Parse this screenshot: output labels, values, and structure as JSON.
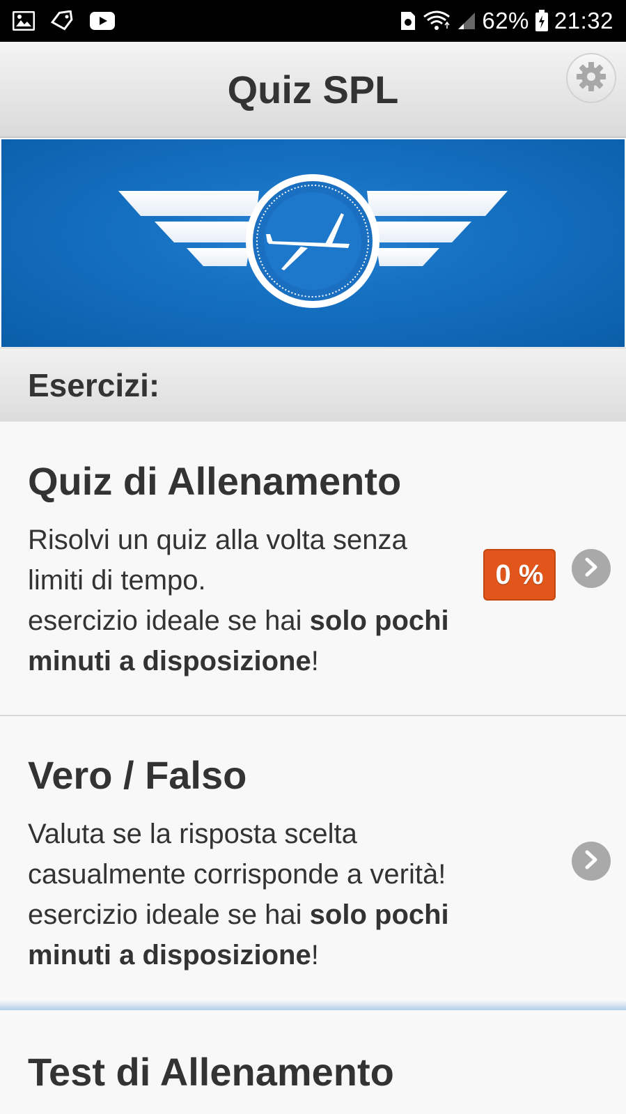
{
  "status_bar": {
    "battery_percent": "62%",
    "time": "21:32",
    "left_icons": [
      "gallery-icon",
      "tag-icon",
      "youtube-icon"
    ],
    "right_icons": [
      "sim-icon",
      "wifi-icon",
      "signal-icon",
      "battery-icon"
    ]
  },
  "header": {
    "title": "Quiz SPL",
    "settings_icon": "gear-icon"
  },
  "banner": {
    "logo": "glider-wings-emblem"
  },
  "section": {
    "title": "Esercizi:"
  },
  "items": [
    {
      "title": "Quiz di Allenamento",
      "desc_line1": "Risolvi un quiz alla volta senza",
      "desc_line2": "limiti di tempo.",
      "desc_line3_prefix": "esercizio ideale se hai ",
      "desc_line3_bold": "solo pochi",
      "desc_line4_bold": "minuti a disposizione",
      "desc_line4_suffix": "!",
      "badge": "0 %"
    },
    {
      "title": "Vero / Falso",
      "desc_line1": "Valuta se la risposta scelta",
      "desc_line2": "casualmente corrisponde a verità!",
      "desc_line3_prefix": "esercizio ideale se hai ",
      "desc_line3_bold": "solo pochi",
      "desc_line4_bold": "minuti a disposizione",
      "desc_line4_suffix": "!"
    },
    {
      "title": "Test di Allenamento"
    }
  ],
  "colors": {
    "banner_blue": "#1772c4",
    "badge_orange": "#e2551b",
    "chevron_grey": "#a9a9a9"
  }
}
